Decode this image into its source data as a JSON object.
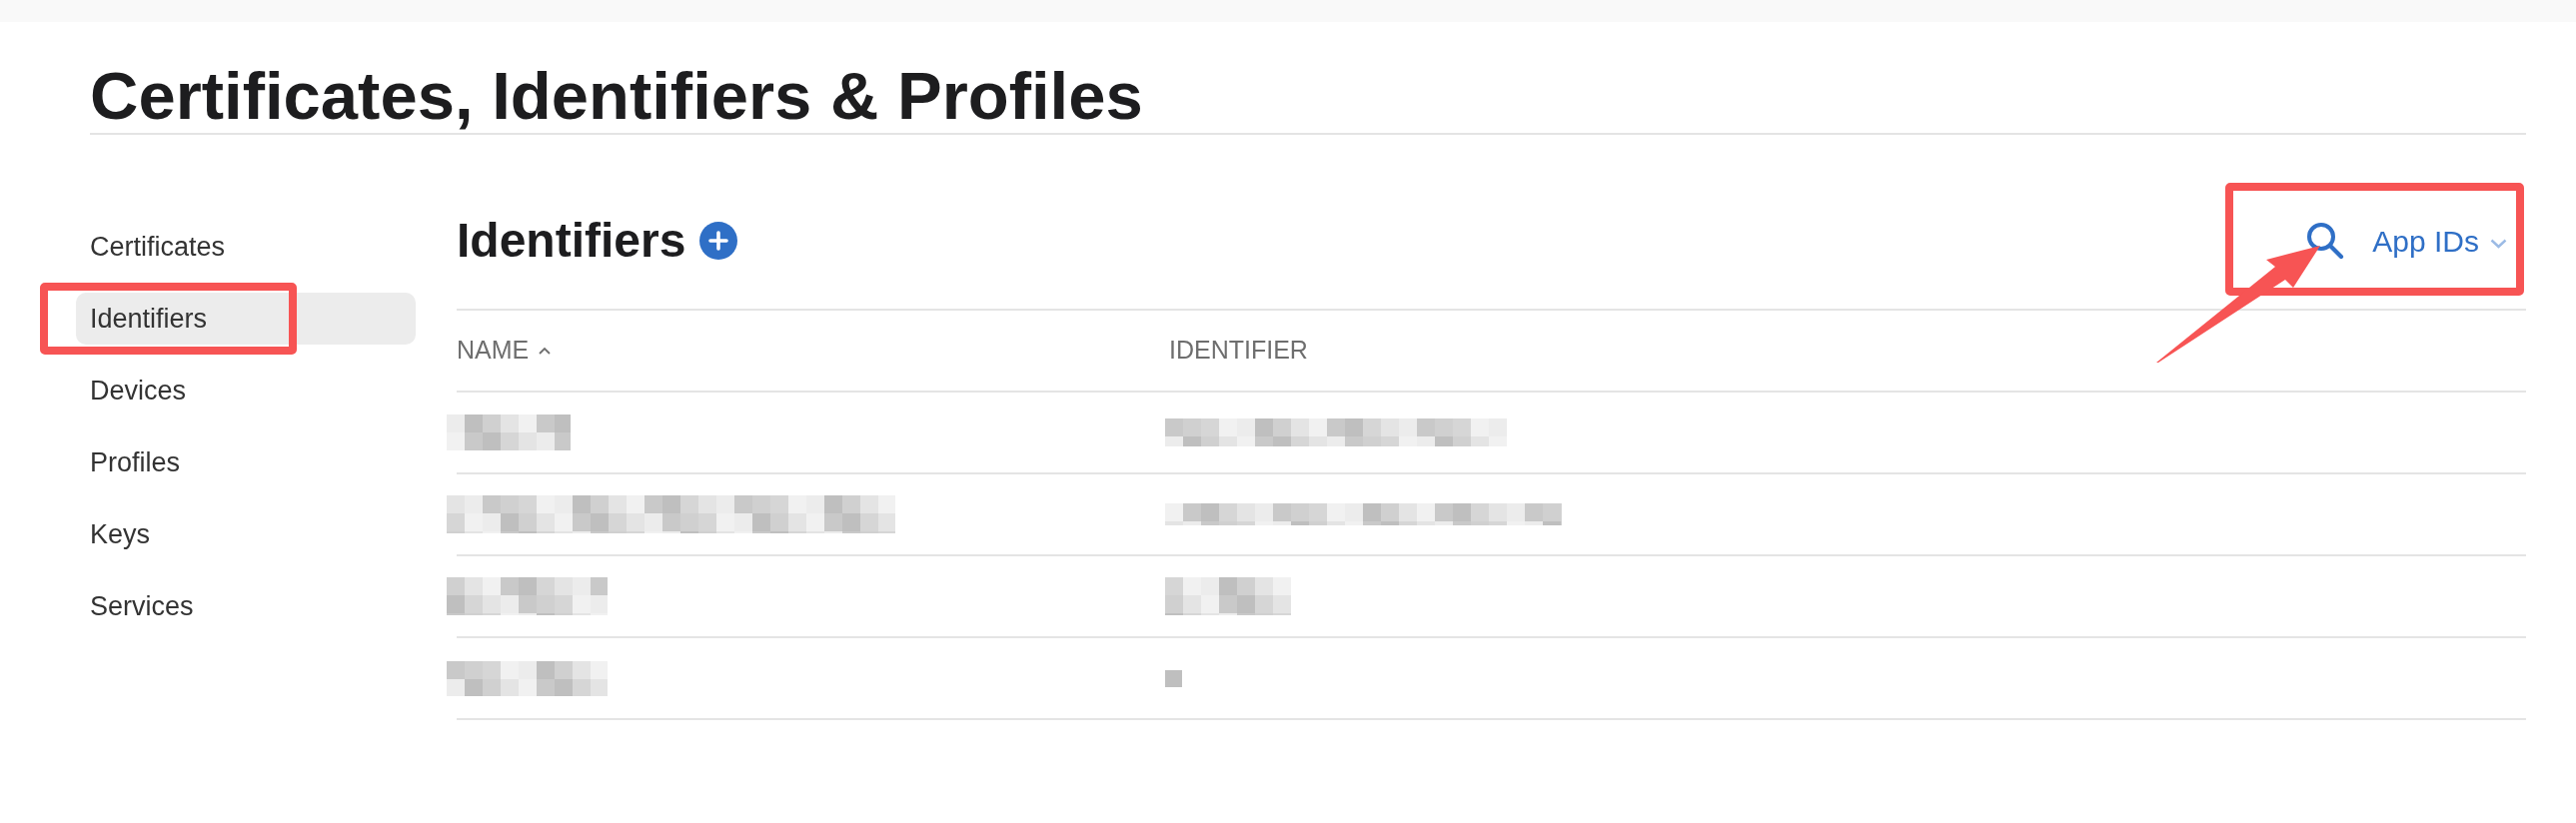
{
  "title": "Certificates, Identifiers & Profiles",
  "sidebar": {
    "items": [
      {
        "label": "Certificates",
        "selected": false,
        "annotated": false
      },
      {
        "label": "Identifiers",
        "selected": true,
        "annotated": true
      },
      {
        "label": "Devices",
        "selected": false,
        "annotated": false
      },
      {
        "label": "Profiles",
        "selected": false,
        "annotated": false
      },
      {
        "label": "Keys",
        "selected": false,
        "annotated": false
      },
      {
        "label": "Services",
        "selected": false,
        "annotated": false
      }
    ]
  },
  "section": {
    "title": "Identifiers",
    "tools": {
      "filter": "App IDs",
      "annotated": true
    }
  },
  "table": {
    "columns": [
      {
        "label": "NAME",
        "sorted": true
      },
      {
        "label": "IDENTIFIER",
        "sorted": false
      }
    ],
    "rows": [
      {
        "cells": [
          {
            "kind": "redacted"
          },
          {
            "kind": "redacted"
          }
        ]
      },
      {
        "cells": [
          {
            "kind": "redacted"
          },
          {
            "kind": "redacted"
          }
        ]
      },
      {
        "cells": [
          {
            "kind": "redacted"
          },
          {
            "kind": "redacted"
          }
        ]
      },
      {
        "cells": [
          {
            "kind": "redacted"
          },
          {
            "kind": "redacted"
          }
        ]
      }
    ]
  }
}
